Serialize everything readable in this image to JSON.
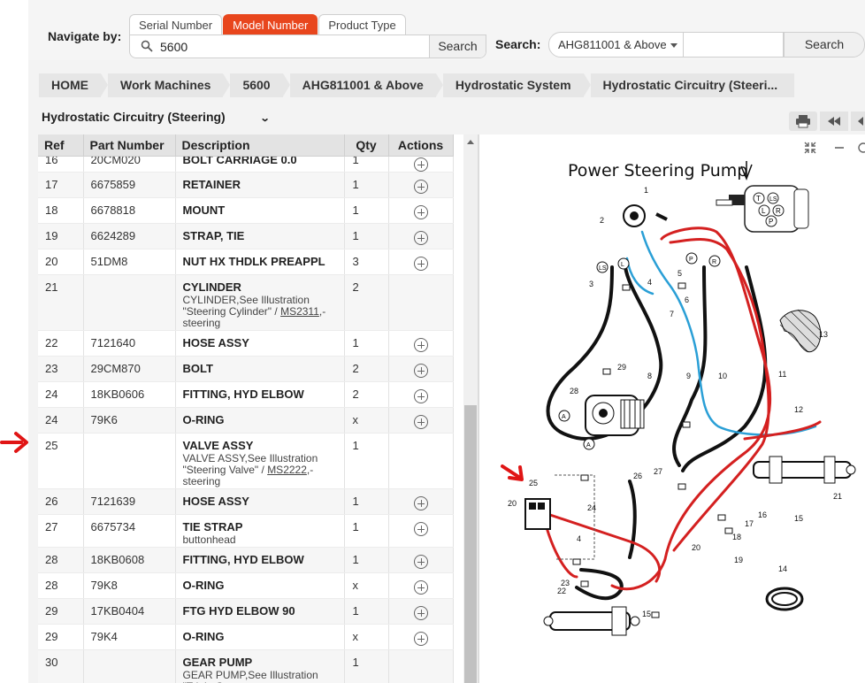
{
  "navigate": {
    "label": "Navigate by:",
    "tabs": [
      "Serial Number",
      "Model Number",
      "Product Type"
    ],
    "active_tab": "Model Number",
    "query": "5600",
    "search_button": "Search"
  },
  "serial_search": {
    "label": "Search:",
    "selected": "AHG811001 & Above",
    "button": "Search"
  },
  "breadcrumb": [
    "HOME",
    "Work Machines",
    "5600",
    "AHG811001 & Above",
    "Hydrostatic System",
    "Hydrostatic Circuitry (Steeri..."
  ],
  "section": {
    "title": "Hydrostatic Circuitry (Steering)"
  },
  "table": {
    "headers": [
      "Ref",
      "Part Number",
      "Description",
      "Qty",
      "Actions"
    ],
    "rows": [
      {
        "ref": "16",
        "part": "20CM020",
        "desc": "BOLT CARRIAGE 0.0",
        "sub": "",
        "qty": "1",
        "action": true
      },
      {
        "ref": "17",
        "part": "6675859",
        "desc": "RETAINER",
        "sub": "",
        "qty": "1",
        "action": true
      },
      {
        "ref": "18",
        "part": "6678818",
        "desc": "MOUNT",
        "sub": "",
        "qty": "1",
        "action": true
      },
      {
        "ref": "19",
        "part": "6624289",
        "desc": "STRAP, TIE",
        "sub": "",
        "qty": "1",
        "action": true
      },
      {
        "ref": "20",
        "part": "51DM8",
        "desc": "NUT HX THDLK PREAPPL",
        "sub": "",
        "qty": "3",
        "action": true
      },
      {
        "ref": "21",
        "part": "",
        "desc": "CYLINDER",
        "sub": "CYLINDER,See Illustration \"Steering Cylinder\" / ",
        "link": "MS2311",
        "sub_after": ",- steering",
        "qty": "2",
        "action": false
      },
      {
        "ref": "22",
        "part": "7121640",
        "desc": "HOSE ASSY",
        "sub": "",
        "qty": "1",
        "action": true
      },
      {
        "ref": "23",
        "part": "29CM870",
        "desc": "BOLT",
        "sub": "",
        "qty": "2",
        "action": true
      },
      {
        "ref": "24",
        "part": "18KB0606",
        "desc": "FITTING, HYD ELBOW",
        "sub": "",
        "qty": "2",
        "action": true
      },
      {
        "ref": "24",
        "part": "79K6",
        "desc": "O-RING",
        "sub": "",
        "qty": "x",
        "action": true
      },
      {
        "ref": "25",
        "part": "",
        "desc": "VALVE ASSY",
        "sub": "VALVE ASSY,See Illustration \"Steering Valve\" / ",
        "link": "MS2222",
        "sub_after": ",- steering",
        "qty": "1",
        "action": false
      },
      {
        "ref": "26",
        "part": "7121639",
        "desc": "HOSE ASSY",
        "sub": "",
        "qty": "1",
        "action": true
      },
      {
        "ref": "27",
        "part": "6675734",
        "desc": "TIE STRAP",
        "sub": "buttonhead",
        "qty": "1",
        "action": true
      },
      {
        "ref": "28",
        "part": "18KB0608",
        "desc": "FITTING, HYD ELBOW",
        "sub": "",
        "qty": "1",
        "action": true
      },
      {
        "ref": "28",
        "part": "79K8",
        "desc": "O-RING",
        "sub": "",
        "qty": "x",
        "action": true
      },
      {
        "ref": "29",
        "part": "17KB0404",
        "desc": "FTG HYD ELBOW 90",
        "sub": "",
        "qty": "1",
        "action": true
      },
      {
        "ref": "29",
        "part": "79K4",
        "desc": "O-RING",
        "sub": "",
        "qty": "x",
        "action": true
      },
      {
        "ref": "30",
        "part": "",
        "desc": "GEAR PUMP",
        "sub": "GEAR PUMP,See Illustration \"Triple Gear",
        "qty": "1",
        "action": false
      }
    ]
  },
  "illustration": {
    "title": "Power Steering Pump",
    "callouts": [
      "1",
      "2",
      "3",
      "4",
      "5",
      "6",
      "7",
      "8",
      "9",
      "10",
      "11",
      "12",
      "13",
      "14",
      "15",
      "16",
      "17",
      "18",
      "19",
      "20",
      "21",
      "22",
      "23",
      "24",
      "25",
      "26",
      "27",
      "28",
      "29"
    ],
    "port_letters": [
      "T",
      "L",
      "LS",
      "P",
      "R",
      "A"
    ]
  },
  "colors": {
    "accent": "#e8461d",
    "hose_red": "#d42020",
    "hose_blue": "#2a9fd6",
    "arrow_red": "#e01515"
  },
  "icons": [
    "search-icon",
    "print-icon",
    "rewind-icon",
    "back-icon",
    "shrink-icon",
    "zoom-out-icon",
    "zoom-in-icon",
    "plus-circle-icon",
    "chevron-down-icon"
  ]
}
